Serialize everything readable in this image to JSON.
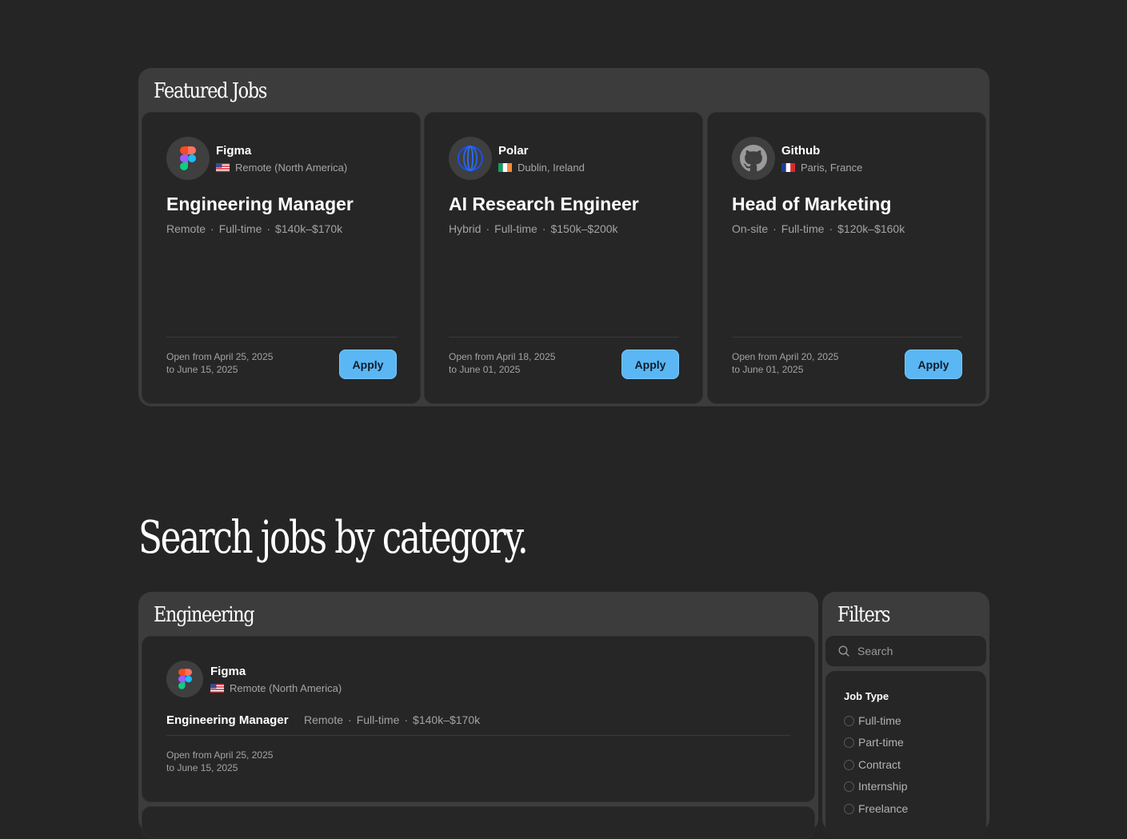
{
  "featured": {
    "title": "Featured Jobs",
    "jobs": [
      {
        "company": "Figma",
        "logo_icon": "figma-logo-icon",
        "flag_icon": "us-flag-icon",
        "location": "Remote (North America)",
        "title": "Engineering Manager",
        "work_mode": "Remote",
        "employment": "Full-time",
        "salary": "$140k–$170k",
        "open_from": "Open from April 25, 2025",
        "open_to": "to June 15, 2025",
        "apply_label": "Apply"
      },
      {
        "company": "Polar",
        "logo_icon": "polar-logo-icon",
        "flag_icon": "ireland-flag-icon",
        "location": "Dublin, Ireland",
        "title": "AI Research Engineer",
        "work_mode": "Hybrid",
        "employment": "Full-time",
        "salary": "$150k–$200k",
        "open_from": "Open from April 18, 2025",
        "open_to": "to June 01, 2025",
        "apply_label": "Apply"
      },
      {
        "company": "Github",
        "logo_icon": "github-logo-icon",
        "flag_icon": "france-flag-icon",
        "location": "Paris, France",
        "title": "Head of Marketing",
        "work_mode": "On-site",
        "employment": "Full-time",
        "salary": "$120k–$160k",
        "open_from": "Open from April 20, 2025",
        "open_to": "to June 01, 2025",
        "apply_label": "Apply"
      }
    ]
  },
  "search_heading": "Search jobs by category.",
  "engineering": {
    "title": "Engineering",
    "job": {
      "company": "Figma",
      "location": "Remote (North America)",
      "title": "Engineering Manager",
      "work_mode": "Remote",
      "employment": "Full-time",
      "salary": "$140k–$170k",
      "open_from": "Open from April 25, 2025",
      "open_to": "to June 15, 2025"
    }
  },
  "filters": {
    "title": "Filters",
    "search_placeholder": "Search",
    "job_type_heading": "Job Type",
    "job_types": [
      "Full-time",
      "Part-time",
      "Contract",
      "Internship",
      "Freelance"
    ]
  },
  "colors": {
    "background": "#252525",
    "panel": "#3c3c3c",
    "card": "#262626",
    "accent": "#5ab7f4"
  },
  "separator": "·"
}
